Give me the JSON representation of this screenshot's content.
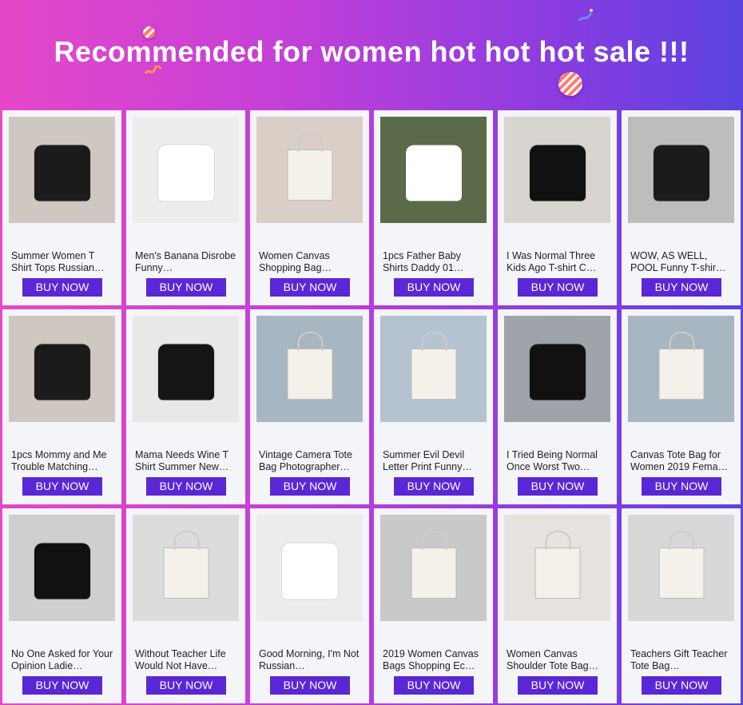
{
  "header": {
    "title": "Recommended for women hot hot hot sale !!!"
  },
  "buy_label": "BUY NOW",
  "products": [
    {
      "name": "Summer Women T Shirt Tops Russian…",
      "bg": "#cfc7c2",
      "item": "#1b1b1b",
      "kind": "shirt"
    },
    {
      "name": "Men's Banana Disrobe Funny…",
      "bg": "#ededed",
      "item": "#ffffff",
      "kind": "shirt"
    },
    {
      "name": "Women Canvas Shopping Bag…",
      "bg": "#d9cfc6",
      "item": "#f3f1ea",
      "kind": "bag"
    },
    {
      "name": "1pcs Father Baby Shirts Daddy 01…",
      "bg": "#5b6b4a",
      "item": "#ffffff",
      "kind": "shirt"
    },
    {
      "name": "I Was Normal Three Kids Ago T-shirt C…",
      "bg": "#d8d4cf",
      "item": "#111111",
      "kind": "shirt"
    },
    {
      "name": "WOW, AS WELL, POOL Funny T-shir…",
      "bg": "#bdbdbd",
      "item": "#1b1b1b",
      "kind": "shirt"
    },
    {
      "name": "1pcs Mommy and Me Trouble Matching…",
      "bg": "#cfc8c1",
      "item": "#1b1b1b",
      "kind": "shirt"
    },
    {
      "name": "Mama Needs Wine T Shirt Summer New…",
      "bg": "#e8e8e8",
      "item": "#151515",
      "kind": "shirt"
    },
    {
      "name": "Vintage Camera Tote Bag Photographer…",
      "bg": "#a7b6c0",
      "item": "#f3f1ea",
      "kind": "bag"
    },
    {
      "name": "Summer Evil Devil Letter Print Funny…",
      "bg": "#b4c3cf",
      "item": "#f3f1ea",
      "kind": "bag"
    },
    {
      "name": "I Tried Being Normal Once Worst Two…",
      "bg": "#9fa4ab",
      "item": "#111111",
      "kind": "shirt"
    },
    {
      "name": "Canvas Tote Bag for Women 2019 Fema…",
      "bg": "#a7b6c0",
      "item": "#f3f1ea",
      "kind": "bag"
    },
    {
      "name": "No One Asked for Your Opinion Ladie…",
      "bg": "#cfcfcf",
      "item": "#111111",
      "kind": "shirt"
    },
    {
      "name": "Without Teacher Life Would Not Have…",
      "bg": "#dcdcdc",
      "item": "#f3f1ea",
      "kind": "bag"
    },
    {
      "name": "Good Morning, I'm Not Russian…",
      "bg": "#ececec",
      "item": "#ffffff",
      "kind": "shirt"
    },
    {
      "name": "2019 Women Canvas Bags Shopping Ec…",
      "bg": "#c9c9c9",
      "item": "#f3f1ea",
      "kind": "bag"
    },
    {
      "name": "Women Canvas Shoulder Tote Bag…",
      "bg": "#e6e2de",
      "item": "#f3f1ea",
      "kind": "bag"
    },
    {
      "name": "Teachers Gift Teacher Tote Bag…",
      "bg": "#d8d8d8",
      "item": "#f3f1ea",
      "kind": "bag"
    }
  ]
}
